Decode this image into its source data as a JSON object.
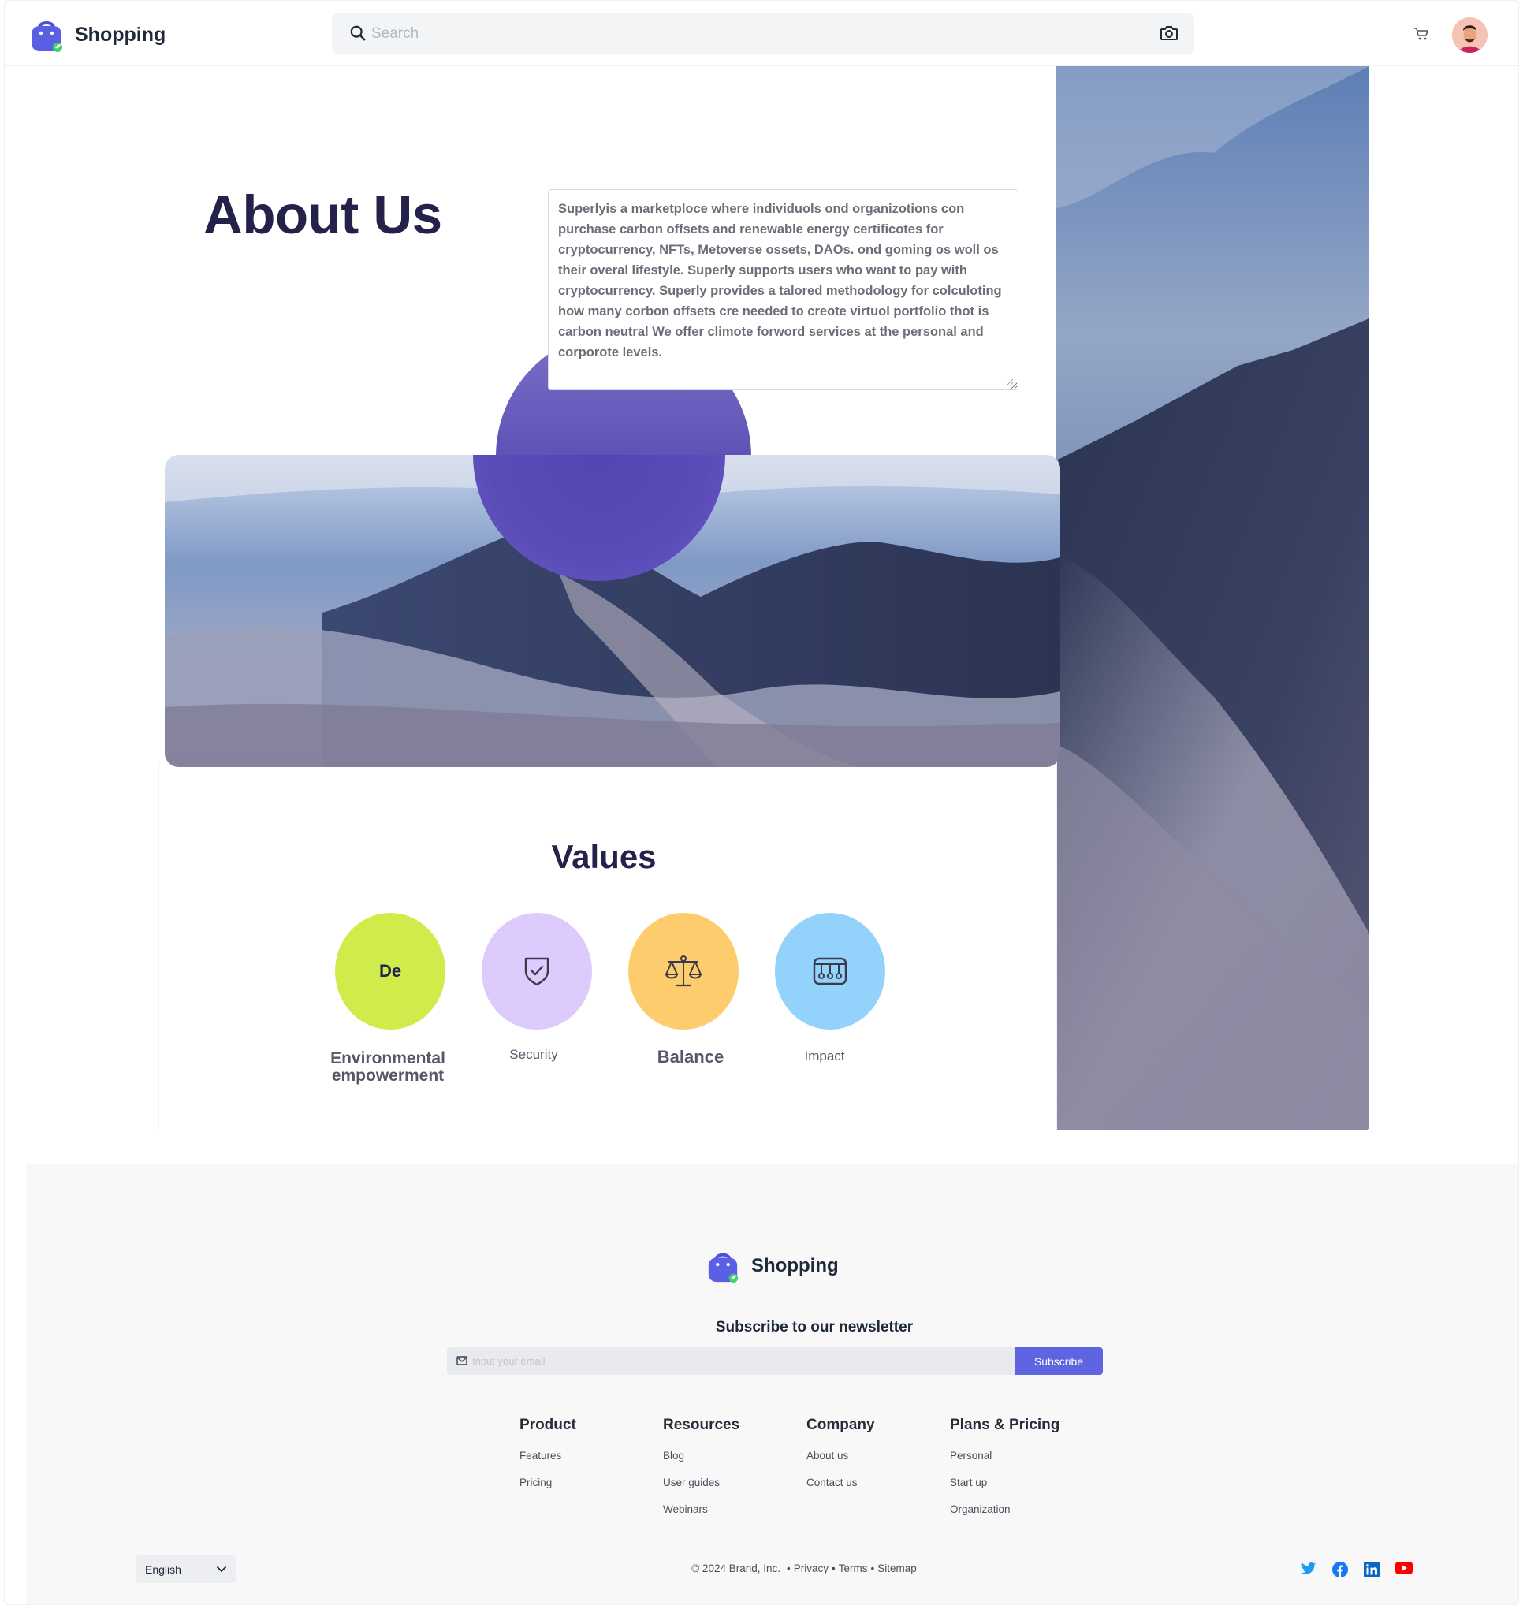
{
  "header": {
    "brand": "Shopping",
    "search_placeholder": "Search"
  },
  "about": {
    "title": "About Us",
    "description": "Superlyis a marketploce where individuols ond organizotions con purchase carbon offsets and renewable energy certificotes for cryptocurrency, NFTs, Metoverse ossets, DAOs. ond goming os woll os their overal lifestyle. Superly supports users who want to pay with cryptocurrency. Superly provides a talored methodology for colculoting how many corbon offsets cre needed to creote virtuol portfolio thot is carbon neutral We offer climote forword services at the personal and corporote levels."
  },
  "values": {
    "title": "Values",
    "items": [
      {
        "icon_text": "De",
        "label": "Environmental empowerment",
        "color": "#cfec4b"
      },
      {
        "icon": "shield-check-icon",
        "label": "Security",
        "color": "#dccbfc"
      },
      {
        "icon": "scale-icon",
        "label": "Balance",
        "color": "#fdcd6d"
      },
      {
        "icon": "impact-icon",
        "label": "Impact",
        "color": "#93d3fb"
      }
    ]
  },
  "footer": {
    "brand": "Shopping",
    "newsletter_title": "Subscribe to our newsletter",
    "email_placeholder": "Input your email",
    "subscribe_label": "Subscribe",
    "columns": [
      {
        "title": "Product",
        "links": [
          "Features",
          "Pricing"
        ]
      },
      {
        "title": "Resources",
        "links": [
          "Blog",
          "User guides",
          "Webinars"
        ]
      },
      {
        "title": "Company",
        "links": [
          "About us",
          "Contact us"
        ]
      },
      {
        "title": "Plans & Pricing",
        "links": [
          "Personal",
          "Start up",
          "Organization"
        ]
      }
    ],
    "language": "English",
    "copyright": "© 2024 Brand, Inc.",
    "legal_links": [
      "Privacy",
      "Terms",
      "Sitemap"
    ],
    "social": [
      "twitter-icon",
      "facebook-icon",
      "linkedin-icon",
      "youtube-icon"
    ]
  },
  "colors": {
    "accent": "#5f64e0",
    "heading": "#24224a",
    "purple_circle": "#5a4cb8"
  }
}
